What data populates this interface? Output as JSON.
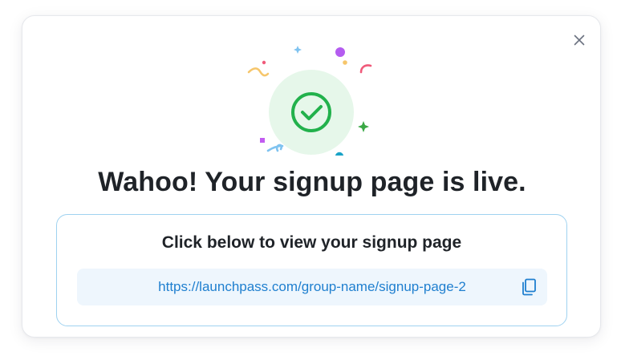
{
  "modal": {
    "title": "Wahoo! Your signup page is live.",
    "card": {
      "heading": "Click below to view your signup page",
      "link": "https://launchpass.com/group-name/signup-page-2"
    }
  },
  "icons": {
    "close": "close-icon",
    "success": "check-circle-icon",
    "copy": "copy-icon"
  },
  "colors": {
    "success_green": "#22b14c",
    "success_bg": "#e6f7ea",
    "link_blue": "#1f7fcf",
    "card_border": "#9fd2f0",
    "link_bg": "#eef6fd"
  }
}
